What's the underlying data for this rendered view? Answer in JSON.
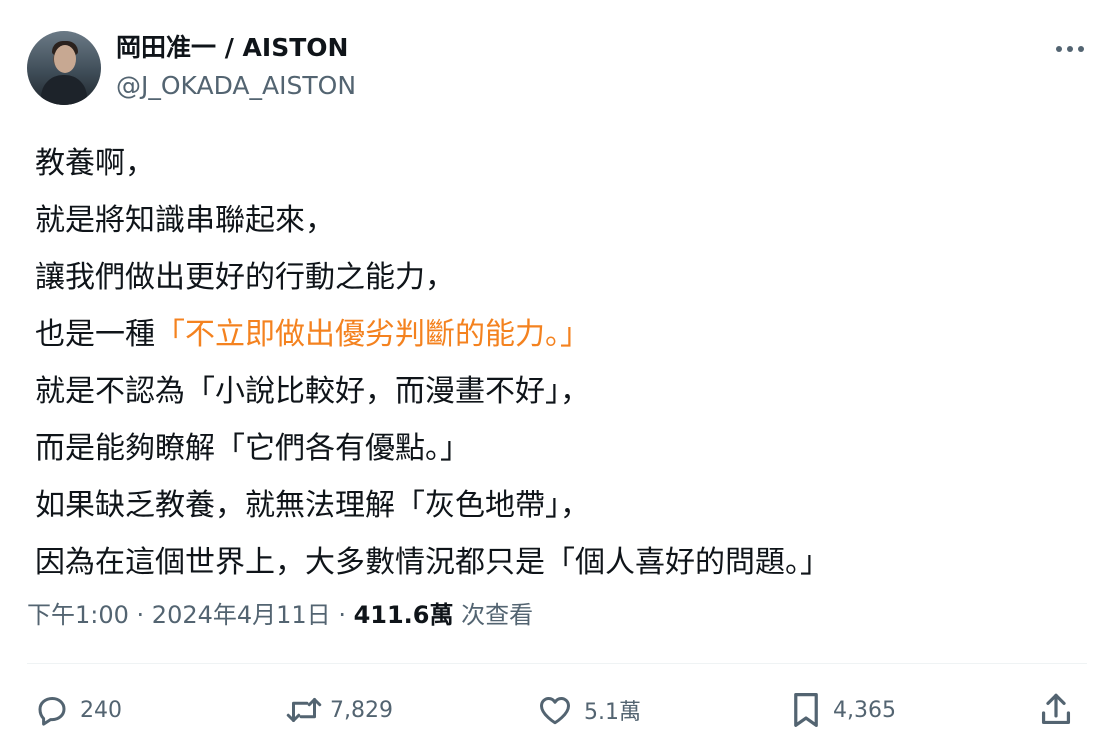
{
  "author": {
    "display_name": "岡田准一 / AISTON",
    "handle": "@J_OKADA_AISTON"
  },
  "tweet": {
    "lines": [
      {
        "before": "教養啊，",
        "highlight": "",
        "after": ""
      },
      {
        "before": "就是將知識串聯起來，",
        "highlight": "",
        "after": ""
      },
      {
        "before": "讓我們做出更好的行動之能力，",
        "highlight": "",
        "after": ""
      },
      {
        "before": "也是一種",
        "highlight": "「不立即做出優劣判斷的能力。」",
        "after": ""
      },
      {
        "before": "就是不認為「小說比較好，而漫畫不好」，",
        "highlight": "",
        "after": ""
      },
      {
        "before": "而是能夠瞭解「它們各有優點。」",
        "highlight": "",
        "after": ""
      },
      {
        "before": "如果缺乏教養，就無法理解「灰色地帶」，",
        "highlight": "",
        "after": ""
      },
      {
        "before": "因為在這個世界上，大多數情況都只是「個人喜好的問題。」",
        "highlight": "",
        "after": ""
      }
    ],
    "highlight_color": "#f4821f"
  },
  "meta": {
    "time": "下午1:00",
    "sep1": " · ",
    "date": "2024年4月11日",
    "sep2": " · ",
    "views_count": "411.6萬",
    "views_label": " 次查看"
  },
  "actions": {
    "reply": {
      "icon": "reply-icon",
      "count": "240"
    },
    "retweet": {
      "icon": "retweet-icon",
      "count": "7,829"
    },
    "like": {
      "icon": "heart-icon",
      "count": "5.1萬"
    },
    "bookmark": {
      "icon": "bookmark-icon",
      "count": "4,365"
    },
    "share": {
      "icon": "share-icon"
    }
  },
  "colors": {
    "text": "#0f1419",
    "secondary": "#536471",
    "accent": "#f4821f"
  }
}
